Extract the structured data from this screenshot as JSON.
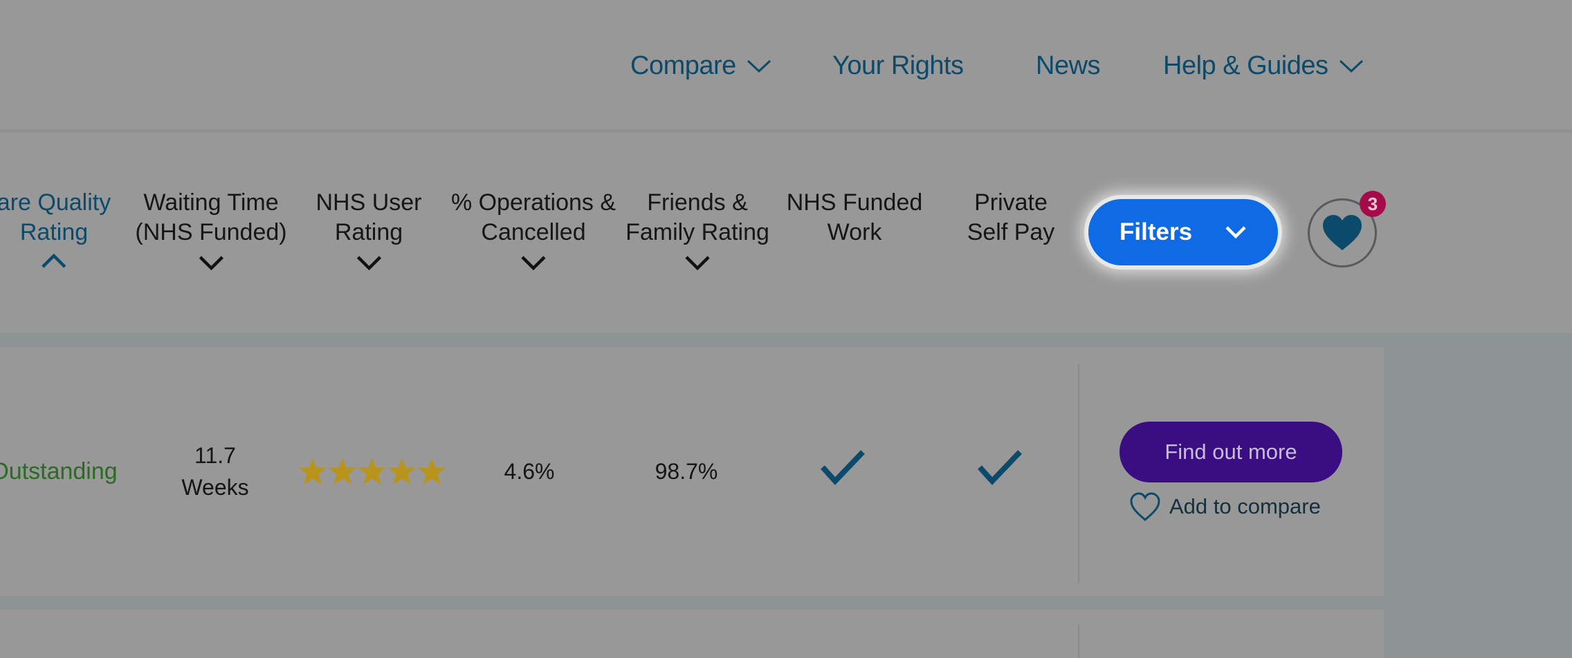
{
  "nav": {
    "items": [
      {
        "label": "Compare",
        "has_dropdown": true
      },
      {
        "label": "Your Rights",
        "has_dropdown": false
      },
      {
        "label": "News",
        "has_dropdown": false
      },
      {
        "label": "Help & Guides",
        "has_dropdown": true
      }
    ]
  },
  "columns": [
    {
      "line1": "are Quality",
      "line2": "Rating",
      "sort": "ascending",
      "active": true
    },
    {
      "line1": "Waiting Time",
      "line2": "(NHS Funded)",
      "sort": "descending",
      "active": false
    },
    {
      "line1": "NHS User",
      "line2": "Rating",
      "sort": "descending",
      "active": false
    },
    {
      "line1": "% Operations &",
      "line2": "Cancelled",
      "sort": "descending",
      "active": false
    },
    {
      "line1": "Friends &",
      "line2": "Family Rating",
      "sort": "descending",
      "active": false
    },
    {
      "line1": "NHS Funded",
      "line2": "Work",
      "sort": null,
      "active": false
    },
    {
      "line1": "Private",
      "line2": "Self Pay",
      "sort": null,
      "active": false
    }
  ],
  "filters_button": {
    "label": "Filters",
    "icon": "chevron-down-icon"
  },
  "favourites": {
    "icon": "heart-icon",
    "count": "3"
  },
  "results": [
    {
      "quality_rating": "Outstanding",
      "waiting_time_value": "11.7",
      "waiting_time_unit": "Weeks",
      "nhs_user_rating_stars": 5,
      "nhs_user_rating_max": 5,
      "operations_cancelled": "4.6%",
      "friends_family_rating": "98.7%",
      "nhs_funded_work": true,
      "private_self_pay": true,
      "find_out_more_label": "Find out more",
      "add_to_compare_label": "Add to compare"
    }
  ],
  "colors": {
    "nav_text": "#0b4a6a",
    "filters_button": "#0f6ae6",
    "badge": "#a50b4a",
    "find_out_more": "#3a0e82",
    "star": "#b8941d",
    "quality_outstanding": "#2b6b23",
    "check": "#0b4a6a"
  }
}
